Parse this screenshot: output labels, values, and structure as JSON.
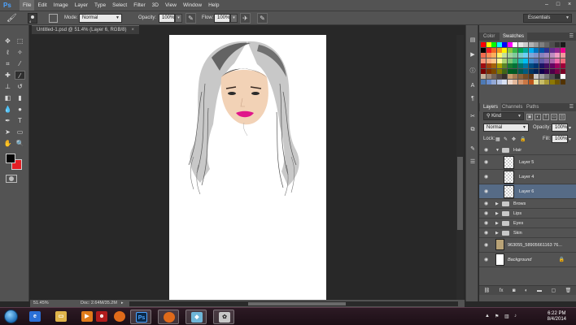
{
  "app": {
    "logo": "Ps"
  },
  "menu": [
    "File",
    "Edit",
    "Image",
    "Layer",
    "Type",
    "Select",
    "Filter",
    "3D",
    "View",
    "Window",
    "Help"
  ],
  "window_buttons": [
    "–",
    "□",
    "×"
  ],
  "options": {
    "brush_size": "4",
    "mode_label": "Mode:",
    "mode_value": "Normal",
    "opacity_label": "Opacity:",
    "opacity_value": "100%",
    "flow_label": "Flow:",
    "flow_value": "100%",
    "workspace": "Essentials"
  },
  "document": {
    "tab_title": "Untitled-1.psd @ 51.4% (Layer 6, RGB/8)",
    "tab_close": "×"
  },
  "status": {
    "zoom": "51.45%",
    "doc_size": "Doc: 2.64M/35.2M"
  },
  "colors": {
    "foreground": "#050505",
    "background": "#e31e24",
    "selected_layer": "#566b86"
  },
  "swatch_panel": {
    "tabs": [
      "Color",
      "Swatches"
    ],
    "colors": [
      [
        "#ff0000",
        "#ffff00",
        "#00ff00",
        "#00ffff",
        "#0000ff",
        "#ff00ff",
        "#ffffff",
        "#e6e6e6",
        "#cccccc",
        "#b3b3b3",
        "#999999",
        "#808080",
        "#666666",
        "#4d4d4d",
        "#333333",
        "#1a1a1a"
      ],
      [
        "#000000",
        "#ed1c24",
        "#f26522",
        "#f7941d",
        "#fff200",
        "#8dc63f",
        "#39b54a",
        "#00a651",
        "#00a99d",
        "#00aeef",
        "#0072bc",
        "#0054a6",
        "#2e3192",
        "#662d91",
        "#92278f",
        "#ec008c"
      ],
      [
        "#f26c4f",
        "#f68e56",
        "#fbaf5d",
        "#fff568",
        "#c4df9b",
        "#a3d39c",
        "#82ca9c",
        "#7accc8",
        "#6dcff6",
        "#7da7d9",
        "#8393ca",
        "#8781bd",
        "#a186be",
        "#bd8cbf",
        "#f49ac2",
        "#f5989d"
      ],
      [
        "#f7977a",
        "#f9ad81",
        "#fdc68a",
        "#fff79a",
        "#acd372",
        "#7cc576",
        "#3bb878",
        "#1abbb4",
        "#00bff3",
        "#448ccb",
        "#5674b9",
        "#605ca8",
        "#855fa8",
        "#a863a8",
        "#f06eaa",
        "#f26d7d"
      ],
      [
        "#9e0b0f",
        "#a0410d",
        "#a36209",
        "#aba000",
        "#598527",
        "#1a7b30",
        "#007236",
        "#00746b",
        "#0076a3",
        "#004b80",
        "#003471",
        "#1b1464",
        "#440e62",
        "#630460",
        "#9e005d",
        "#9e0039"
      ],
      [
        "#790000",
        "#7b2e00",
        "#7d4900",
        "#827b00",
        "#406618",
        "#005e20",
        "#005826",
        "#005952",
        "#005b7f",
        "#003663",
        "#002157",
        "#0d004c",
        "#32004b",
        "#4b0049",
        "#7b0046",
        "#7a0026"
      ],
      [
        "#c7b299",
        "#998675",
        "#736357",
        "#534741",
        "#37302d",
        "#c69c6d",
        "#a67c52",
        "#8c6239",
        "#754c24",
        "#603913",
        "#c8c8c8",
        "#a0a0a0",
        "#787878",
        "#505050",
        "#282828",
        "#ffffff"
      ],
      [
        "#4d7ab5",
        "#6b8fcf",
        "#93a9d6",
        "#b7c5e5",
        "#d9e1f2",
        "#efd8c9",
        "#e2b89c",
        "#d6986f",
        "#c97745",
        "#bd561b",
        "#e6e0a0",
        "#c8bd6a",
        "#aa9a36",
        "#8d7803",
        "#6f5500",
        "#523300"
      ]
    ]
  },
  "layers_panel": {
    "tabs": [
      "Layers",
      "Channels",
      "Paths"
    ],
    "kind_label": "Kind",
    "blend_mode": "Normal",
    "opacity_label": "Opacity:",
    "opacity_value": "100%",
    "lock_label": "Lock:",
    "fill_label": "Fill:",
    "fill_value": "100%",
    "layers": [
      {
        "name": "Hair",
        "type": "group",
        "expanded": true,
        "indent": 0,
        "selected": false
      },
      {
        "name": "Layer 5",
        "type": "layer",
        "indent": 1,
        "selected": false
      },
      {
        "name": "Layer 4",
        "type": "layer",
        "indent": 1,
        "selected": false
      },
      {
        "name": "Layer 6",
        "type": "layer",
        "indent": 1,
        "selected": true
      },
      {
        "name": "Brows",
        "type": "group",
        "expanded": false,
        "indent": 0,
        "selected": false
      },
      {
        "name": "Lips",
        "type": "group",
        "expanded": false,
        "indent": 0,
        "selected": false
      },
      {
        "name": "Eyes",
        "type": "group",
        "expanded": false,
        "indent": 0,
        "selected": false
      },
      {
        "name": "Skin",
        "type": "group",
        "expanded": false,
        "indent": 0,
        "selected": false
      },
      {
        "name": "963055_58905661163 76...",
        "type": "photo",
        "indent": 0,
        "selected": false
      },
      {
        "name": "Background",
        "type": "background",
        "indent": 0,
        "selected": false,
        "locked": true
      }
    ],
    "footer_icons": [
      "link-icon",
      "fx-icon",
      "mask-icon",
      "adjustment-icon",
      "new-group-icon",
      "new-layer-icon",
      "trash-icon"
    ]
  },
  "taskbar": {
    "apps": [
      "ie-icon",
      "explorer-icon",
      "media-icon",
      "user-icon",
      "firefox-icon",
      "photoshop-icon",
      "firefox-icon",
      "app-icon",
      "paint-icon"
    ],
    "time": "6:22 PM",
    "date": "8/4/2014"
  }
}
